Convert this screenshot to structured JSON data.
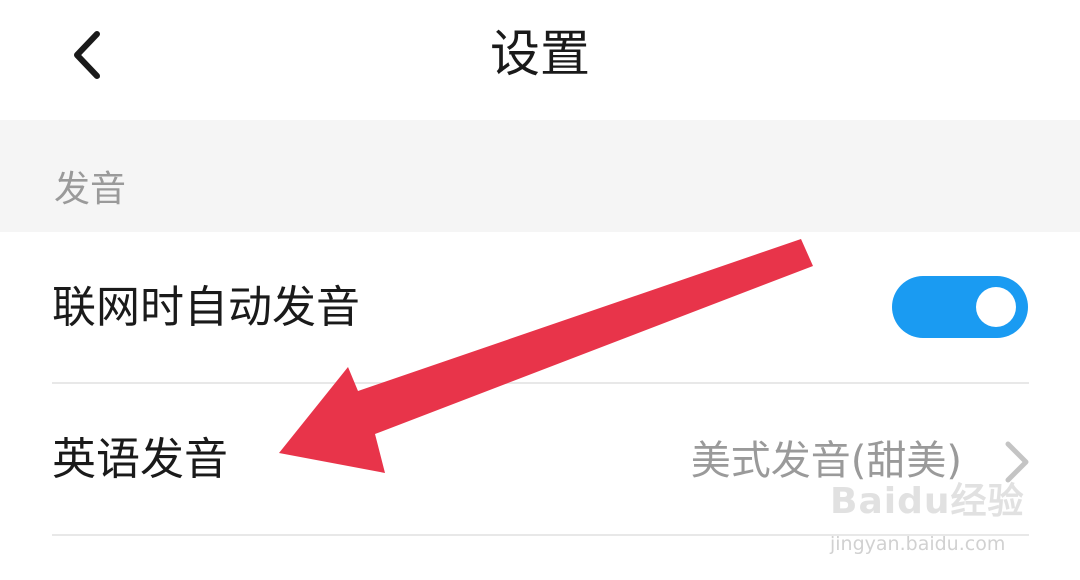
{
  "header": {
    "title": "设置",
    "back_icon": "chevron-left-icon"
  },
  "section": {
    "title": "发音"
  },
  "settings": {
    "auto_pronounce": {
      "label": "联网时自动发音",
      "enabled": true
    },
    "english_pronunciation": {
      "label": "英语发音",
      "value": "美式发音(甜美)",
      "icon": "chevron-right-icon"
    }
  },
  "annotation": {
    "icon": "red-arrow-icon",
    "color": "#e8344a"
  },
  "watermark": {
    "brand": "Baidu经验",
    "url": "jingyan.baidu.com"
  },
  "colors": {
    "accent": "#1a9bf2",
    "section_background": "#f5f5f5",
    "secondary_text": "#9a9a9a",
    "divider": "#e8e8e8"
  }
}
